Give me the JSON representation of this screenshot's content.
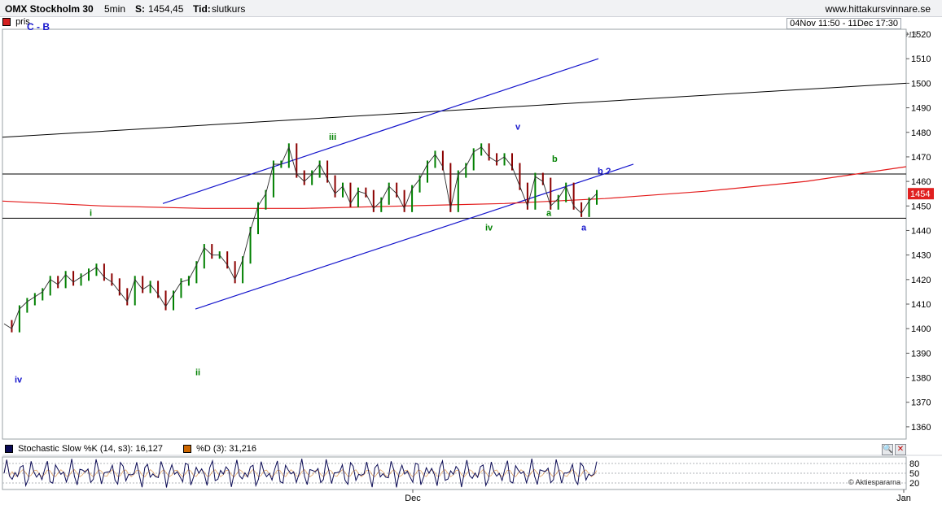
{
  "header": {
    "instrument": "OMX Stockholm 30",
    "interval": "5min",
    "last_label": "S:",
    "last_value": "1454,45",
    "time_label": "Tid:",
    "time_value": "slutkurs",
    "website": "www.hittakursvinnare.se"
  },
  "legend": {
    "series_name": "pris"
  },
  "date_range": "04Nov 11:50 - 11Dec 17:30",
  "year_label": "2015",
  "watermark": "© Aktiespararna",
  "colors": {
    "price_up": "#008000",
    "price_down": "#8b0000",
    "channel": "#1515cc",
    "trend": "#000000",
    "arc": "#e31a1a",
    "stoch_k": "#0b0b55",
    "stoch_d": "#cc6600",
    "last_price_box": "#e02020"
  },
  "chart_data": {
    "type": "line",
    "title": "OMX Stockholm 30",
    "x": [
      "04Nov 11:50",
      "Dec",
      "11Dec 17:30",
      "Jan"
    ],
    "x_tick_labels": [
      "Dec",
      "Jan"
    ],
    "ylim": [
      1355,
      1522
    ],
    "y_ticks": [
      1360,
      1370,
      1380,
      1390,
      1400,
      1410,
      1420,
      1430,
      1440,
      1450,
      1460,
      1470,
      1480,
      1490,
      1500,
      1510,
      1520
    ],
    "last_price_label": "1454",
    "series": [
      {
        "name": "pris",
        "values": [
          1402,
          1400,
          1408,
          1411,
          1413,
          1415,
          1420,
          1418,
          1422,
          1419,
          1421,
          1423,
          1425,
          1421,
          1419,
          1415,
          1411,
          1420,
          1416,
          1418,
          1414,
          1409,
          1414,
          1419,
          1420,
          1426,
          1433,
          1430,
          1430,
          1426,
          1420,
          1428,
          1440,
          1450,
          1455,
          1467,
          1467,
          1474,
          1463,
          1460,
          1463,
          1467,
          1461,
          1455,
          1458,
          1451,
          1456,
          1455,
          1449,
          1452,
          1458,
          1455,
          1449,
          1457,
          1461,
          1467,
          1471,
          1466,
          1449,
          1463,
          1466,
          1472,
          1474,
          1470,
          1468,
          1470,
          1466,
          1458,
          1450,
          1462,
          1460,
          1450,
          1453,
          1458,
          1450,
          1447,
          1452,
          1455
        ]
      }
    ],
    "horizontal_lines": [
      1463,
      1445
    ],
    "channel_upper": {
      "from": [
        0.0,
        1451
      ],
      "to": [
        1.0,
        1510
      ]
    },
    "channel_lower": {
      "from": [
        0.0,
        1408
      ],
      "to": [
        1.0,
        1467
      ]
    },
    "trend_line": {
      "from": [
        0.0,
        1478
      ],
      "to": [
        1.0,
        1500
      ]
    },
    "arc_line": [
      [
        1452
      ],
      [
        1450
      ],
      [
        1449
      ],
      [
        1449
      ],
      [
        1450
      ],
      [
        1451
      ],
      [
        1453
      ],
      [
        1456
      ],
      [
        1460
      ],
      [
        1466
      ]
    ],
    "wave_labels": [
      {
        "text": "iv",
        "y": 1378,
        "color": "#1515cc"
      },
      {
        "text": "i",
        "y": 1446,
        "color": "#008000"
      },
      {
        "text": "ii",
        "y": 1381,
        "color": "#008000"
      },
      {
        "text": "iii",
        "y": 1477,
        "color": "#008000"
      },
      {
        "text": "iv",
        "y": 1440,
        "color": "#008000"
      },
      {
        "text": "v",
        "y": 1481,
        "color": "#1515cc"
      },
      {
        "text": "b",
        "y": 1468,
        "color": "#008000"
      },
      {
        "text": "a",
        "y": 1446,
        "color": "#008000"
      },
      {
        "text": "a",
        "y": 1440,
        "color": "#1515cc"
      },
      {
        "text": "b ?",
        "y": 1463,
        "color": "#1515cc"
      },
      {
        "text": "C - B",
        "y": 1522,
        "color": "#1515cc"
      }
    ],
    "indicator": {
      "k_label": "Stochastic Slow %K (14, s3): 16,127",
      "d_label": "%D (3): 31,216",
      "ylim": [
        0,
        100
      ],
      "levels": [
        20,
        50,
        80
      ],
      "level_labels": [
        "80",
        "50",
        "20"
      ]
    }
  }
}
